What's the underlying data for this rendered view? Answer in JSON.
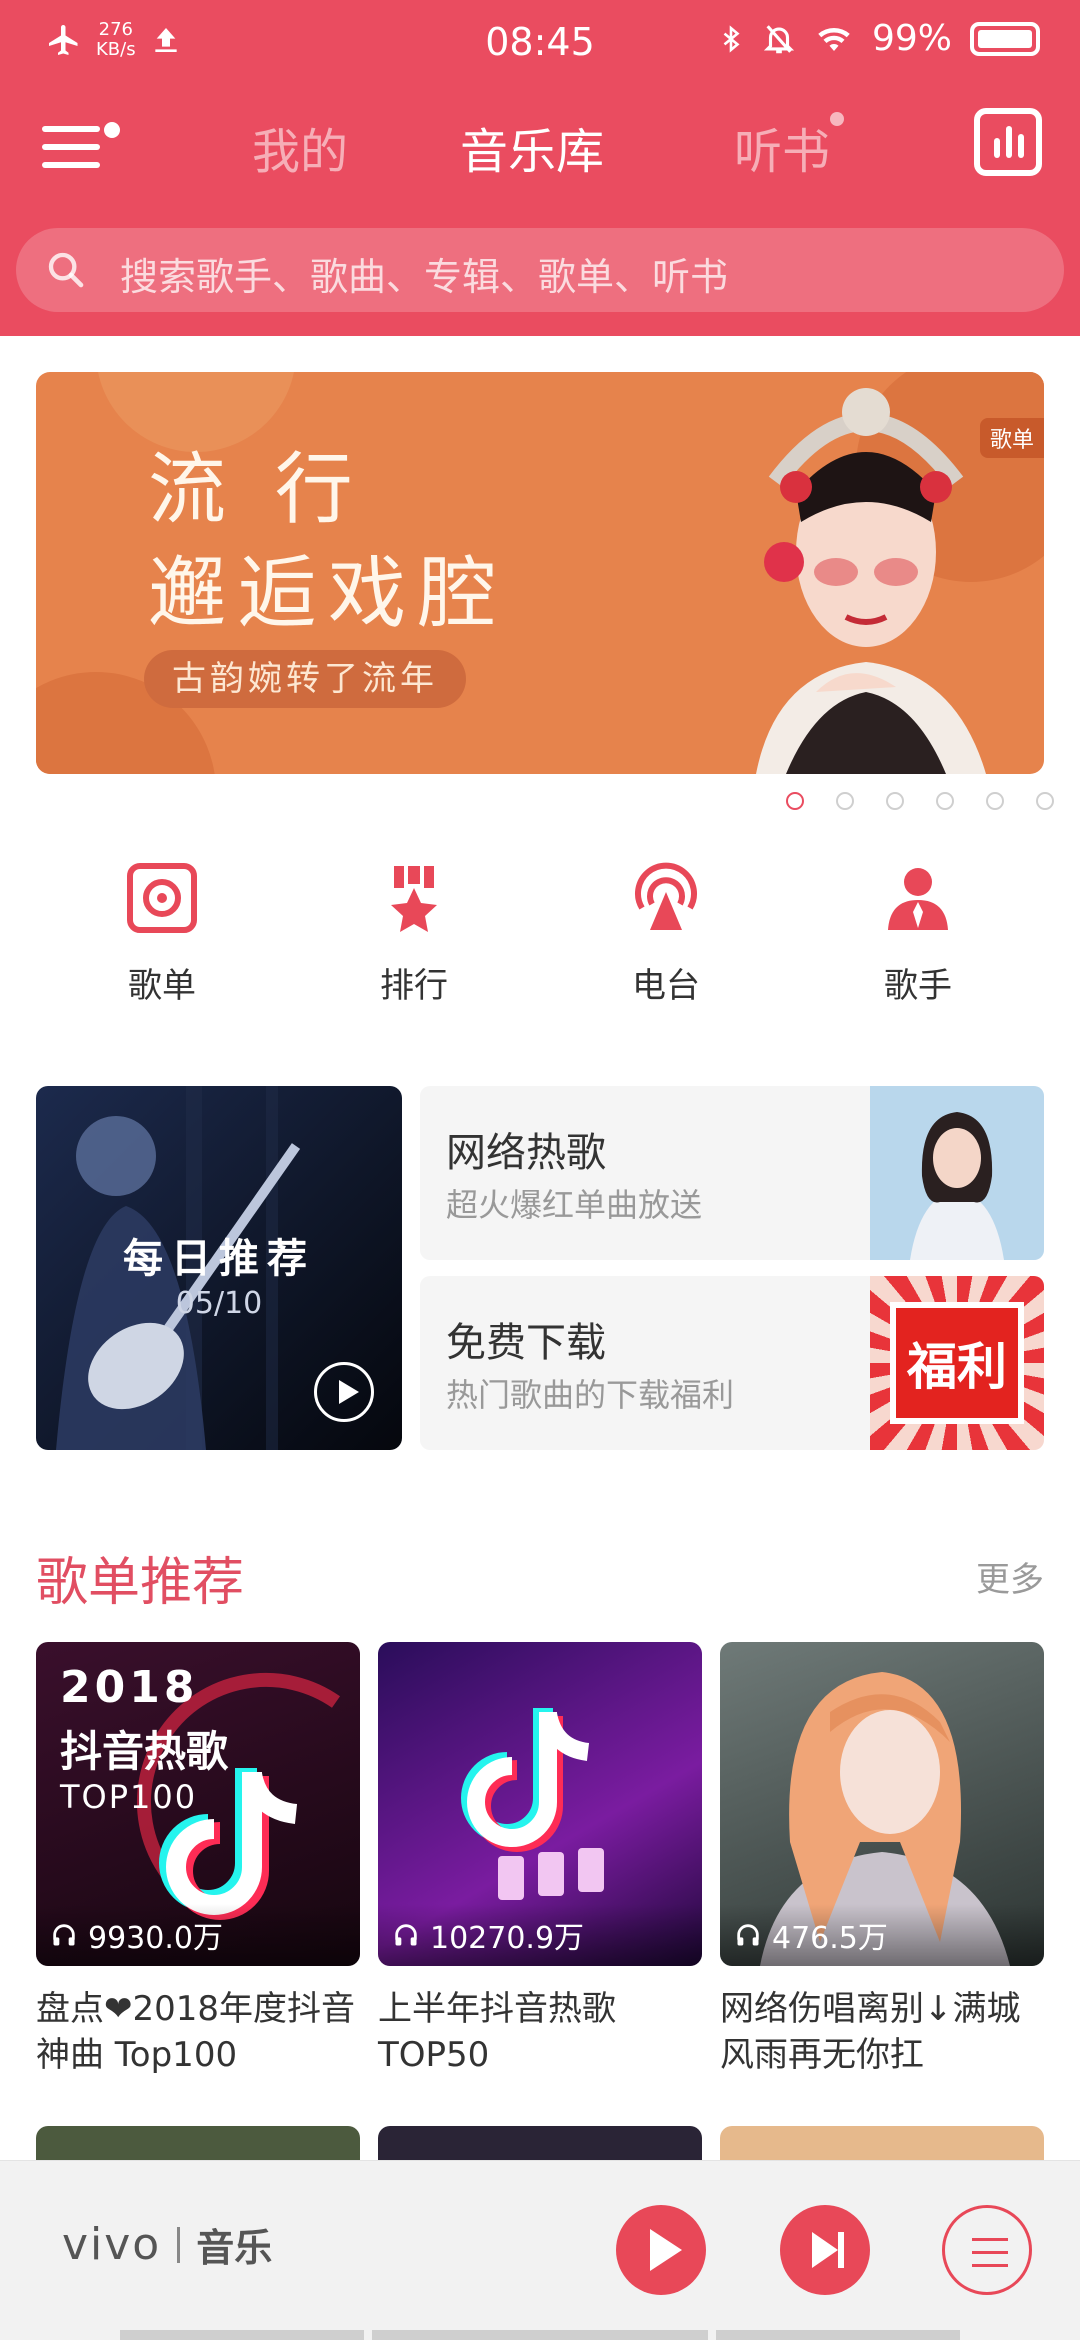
{
  "status_bar": {
    "net_speed_value": "276",
    "net_speed_unit": "KB/s",
    "time": "08:45",
    "battery": "99%"
  },
  "nav": {
    "tabs": [
      "我的",
      "音乐库",
      "听书"
    ],
    "active_tab": "音乐库"
  },
  "search": {
    "placeholder": "搜索歌手、歌曲、专辑、歌单、听书"
  },
  "banner": {
    "title_line1": "流 行",
    "title_line2": "邂逅戏腔",
    "subtitle": "古韵婉转了流年",
    "tag": "歌单",
    "page_count": 6,
    "active_page": 1
  },
  "quick_entries": [
    {
      "label": "歌单",
      "icon": "playlist-icon"
    },
    {
      "label": "排行",
      "icon": "ranking-icon"
    },
    {
      "label": "电台",
      "icon": "radio-icon"
    },
    {
      "label": "歌手",
      "icon": "singer-icon"
    }
  ],
  "daily": {
    "title": "每日推荐",
    "date": "05/10"
  },
  "features": [
    {
      "title": "网络热歌",
      "subtitle": "超火爆红单曲放送"
    },
    {
      "title": "免费下载",
      "subtitle": "热门歌曲的下载福利",
      "badge": "福利"
    }
  ],
  "playlist_section": {
    "title": "歌单推荐",
    "more": "更多",
    "items": [
      {
        "title": "盘点❤2018年度抖音神曲 Top100",
        "plays": "9930.0万",
        "cover_year": "2018",
        "cover_line": "抖音热歌",
        "cover_top": "TOP100"
      },
      {
        "title": "上半年抖音热歌TOP50",
        "plays": "10270.9万"
      },
      {
        "title": "网络伤唱离别↓满城风雨再无你扛",
        "plays": "476.5万"
      }
    ]
  },
  "player": {
    "brand": "vivo",
    "brand_suffix": "音乐"
  },
  "colors": {
    "accent": "#ea4c60",
    "banner": "#e6834c"
  }
}
